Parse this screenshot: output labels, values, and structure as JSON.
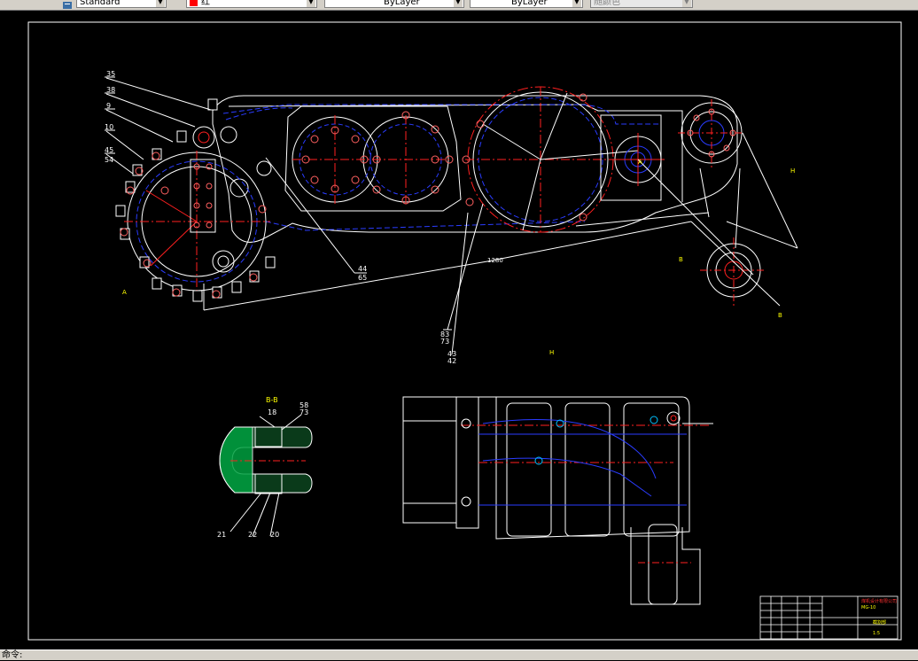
{
  "toolbar": {
    "text_style": "Standard",
    "color": "红",
    "color_swatch": "#ff0000",
    "linetype": "ByLayer",
    "lineweight": "ByLayer",
    "plot_style": "随颜色"
  },
  "drawing": {
    "callouts_main": [
      "35",
      "38",
      "9",
      "10",
      "45",
      "54",
      "44",
      "65",
      "83",
      "73",
      "43",
      "42"
    ],
    "section_label": "B-B",
    "section_callouts": [
      "18",
      "58",
      "73",
      "21",
      "22",
      "20"
    ],
    "view_label_h": "H",
    "label_a": "A",
    "label_b": "B",
    "dimension": "1280",
    "title_block": {
      "company": "煤机设计有限公司",
      "code": "MG-10",
      "drawing_name": "截割部",
      "scale": "1:5"
    }
  },
  "status": {
    "command": "命令:"
  }
}
